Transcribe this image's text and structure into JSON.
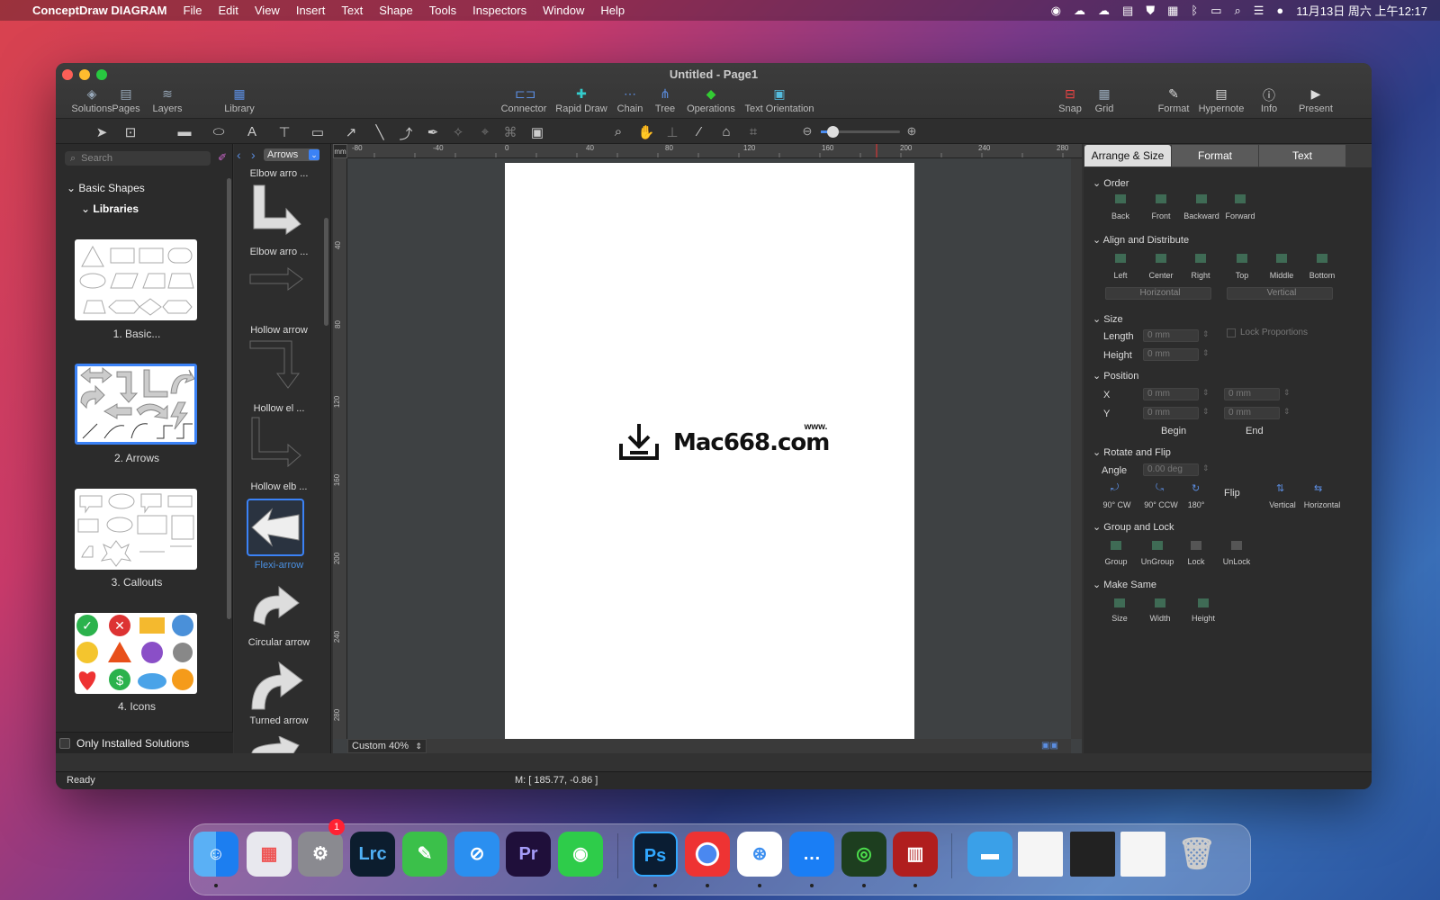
{
  "menubar": {
    "apple": "",
    "app": "ConceptDraw DIAGRAM",
    "items": [
      "File",
      "Edit",
      "View",
      "Insert",
      "Text",
      "Shape",
      "Tools",
      "Inspectors",
      "Window",
      "Help"
    ],
    "clock": "11月13日 周六 上午12:17"
  },
  "window": {
    "title": "Untitled - Page1"
  },
  "toolbar": {
    "left": [
      "Solutions",
      "Pages",
      "Layers",
      "Library"
    ],
    "center": [
      "Connector",
      "Rapid Draw",
      "Chain",
      "Tree",
      "Operations",
      "Text Orientation"
    ],
    "right": [
      "Snap",
      "Grid",
      "Format",
      "Hypernote",
      "Info",
      "Present"
    ]
  },
  "left": {
    "search_placeholder": "Search",
    "tree_root": "Basic Shapes",
    "tree_child": "Libraries",
    "libs": [
      "1. Basic...",
      "2. Arrows",
      "3. Callouts",
      "4. Icons"
    ],
    "only_installed": "Only Installed Solutions"
  },
  "stencil": {
    "dropdown": "Arrows",
    "items": [
      "Elbow arro ...",
      "Elbow arro ...",
      "Hollow arrow",
      "Hollow el ...",
      "Hollow elb ...",
      "Flexi-arrow",
      "Circular arrow",
      "Turned arrow"
    ]
  },
  "canvas": {
    "ruler_unit": "mm",
    "ruler_h": [
      "-80",
      "-40",
      "0",
      "40",
      "80",
      "120",
      "160",
      "200",
      "240",
      "280"
    ],
    "ruler_v": [
      "40",
      "80",
      "120",
      "160",
      "200",
      "240",
      "280"
    ],
    "zoom": "Custom 40%",
    "watermark_www": "www.",
    "watermark": "Mac668.com"
  },
  "right": {
    "tabs": [
      "Arrange & Size",
      "Format",
      "Text"
    ],
    "order": {
      "title": "Order",
      "btns": [
        "Back",
        "Front",
        "Backward",
        "Forward"
      ]
    },
    "align": {
      "title": "Align and Distribute",
      "btns": [
        "Left",
        "Center",
        "Right",
        "Top",
        "Middle",
        "Bottom"
      ],
      "h": "Horizontal",
      "v": "Vertical"
    },
    "size": {
      "title": "Size",
      "length": "Length",
      "height": "Height",
      "lval": "0 mm",
      "hval": "0 mm",
      "lock": "Lock Proportions"
    },
    "position": {
      "title": "Position",
      "x": "X",
      "y": "Y",
      "val": "0 mm",
      "begin": "Begin",
      "end": "End"
    },
    "rotate": {
      "title": "Rotate and Flip",
      "angle": "Angle",
      "aval": "0.00 deg",
      "btns": [
        "90° CW",
        "90° CCW",
        "180°"
      ],
      "flip": "Flip",
      "fbtns": [
        "Vertical",
        "Horizontal"
      ]
    },
    "group": {
      "title": "Group and Lock",
      "btns": [
        "Group",
        "UnGroup",
        "Lock",
        "UnLock"
      ]
    },
    "same": {
      "title": "Make Same",
      "btns": [
        "Size",
        "Width",
        "Height"
      ]
    }
  },
  "status": {
    "ready": "Ready",
    "coords": "M: [ 185.77, -0.86 ]"
  },
  "dock": {
    "badge": "1",
    "apps": [
      "Finder",
      "Launchpad",
      "System Preferences",
      "Lrc",
      "Notes",
      "Safari",
      "Pr",
      "WeChat",
      "Ps",
      "Chrome",
      "Baidu",
      "Messages",
      "Podcast",
      "Archive",
      "Folder",
      "Trash"
    ]
  }
}
